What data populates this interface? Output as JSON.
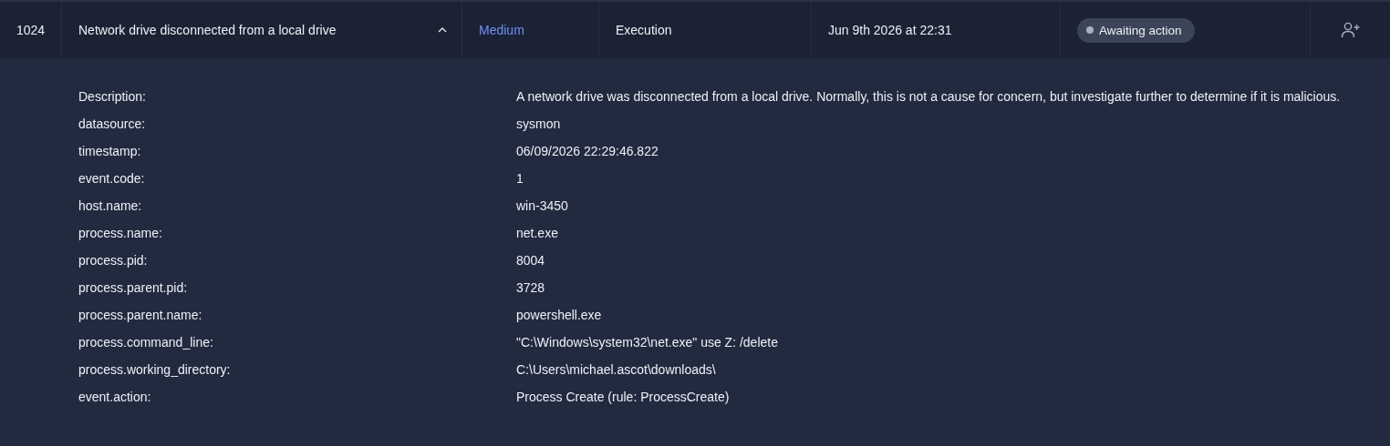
{
  "alert": {
    "id": "1024",
    "title": "Network drive disconnected from a local drive",
    "expanded": true,
    "severity": "Medium",
    "tactic": "Execution",
    "time": "Jun 9th 2026 at 22:31",
    "status": "Awaiting action"
  },
  "details": [
    {
      "label": "Description:",
      "value": "A network drive was disconnected from a local drive. Normally, this is not a cause for concern, but investigate further to determine if it is malicious."
    },
    {
      "label": "datasource:",
      "value": "sysmon"
    },
    {
      "label": "timestamp:",
      "value": "06/09/2026 22:29:46.822"
    },
    {
      "label": "event.code:",
      "value": "1"
    },
    {
      "label": "host.name:",
      "value": "win-3450"
    },
    {
      "label": "process.name:",
      "value": "net.exe"
    },
    {
      "label": "process.pid:",
      "value": "8004"
    },
    {
      "label": "process.parent.pid:",
      "value": "3728"
    },
    {
      "label": "process.parent.name:",
      "value": "powershell.exe"
    },
    {
      "label": "process.command_line:",
      "value": "\"C:\\Windows\\system32\\net.exe\" use Z: /delete"
    },
    {
      "label": "process.working_directory:",
      "value": "C:\\Users\\michael.ascot\\downloads\\"
    },
    {
      "label": "event.action:",
      "value": "Process Create (rule: ProcessCreate)"
    }
  ]
}
